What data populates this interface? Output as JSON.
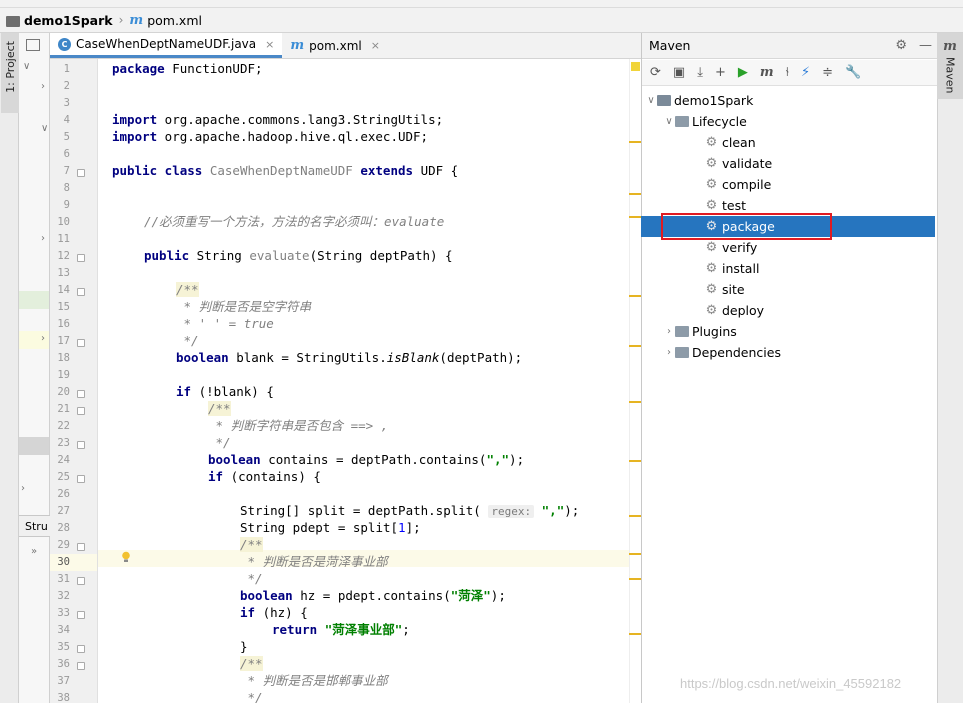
{
  "breadcrumb": {
    "project": "demo1Spark",
    "file": "pom.xml"
  },
  "left_tabs": {
    "project": "1: Project",
    "structure": "Stru"
  },
  "editor_tabs": [
    {
      "label": "CaseWhenDeptNameUDF.java",
      "close": "×",
      "active": true
    },
    {
      "label": "pom.xml",
      "close": "×",
      "active": false
    }
  ],
  "line_numbers": [
    "1",
    "2",
    "3",
    "4",
    "5",
    "6",
    "7",
    "8",
    "9",
    "10",
    "11",
    "12",
    "13",
    "14",
    "15",
    "16",
    "17",
    "18",
    "19",
    "20",
    "21",
    "22",
    "23",
    "24",
    "25",
    "26",
    "27",
    "28",
    "29",
    "30",
    "31",
    "32",
    "33",
    "34",
    "35",
    "36",
    "37",
    "38"
  ],
  "code": {
    "l1a": "package",
    "l1b": " FunctionUDF;",
    "l4a": "import",
    "l4b": " org.apache.commons.lang3.StringUtils;",
    "l5a": "import",
    "l5b": " org.apache.hadoop.hive.ql.exec.UDF;",
    "l7a": "public class",
    "l7b": " CaseWhenDeptNameUDF ",
    "l7c": "extends",
    "l7d": " UDF {",
    "l10": "//必须重写一个方法，方法的名字必须叫：evaluate",
    "l12a": "public",
    "l12b": " String ",
    "l12c": "evaluate",
    "l12d": "(String deptPath) {",
    "l14": "/**",
    "l15": " * 判断是否是空字符串",
    "l16a": " * ' ' = ",
    "l16b": "true",
    "l17": " */",
    "l18a": "boolean",
    "l18b": " blank = StringUtils.",
    "l18c": "isBlank",
    "l18d": "(deptPath);",
    "l20a": "if",
    "l20b": " (!blank) {",
    "l21": "/**",
    "l22": " * 判断字符串是否包含 ==> ,",
    "l23": " */",
    "l24a": "boolean",
    "l24b": " contains = deptPath.contains(",
    "l24c": "\",\"",
    "l24d": ");",
    "l25a": "if",
    "l25b": " (contains) {",
    "l27a": "String[] split = deptPath.split( ",
    "l27hint": "regex:",
    "l27b": " ",
    "l27c": "\",\"",
    "l27d": ");",
    "l28a": "String pdept = split[",
    "l28b": "1",
    "l28c": "];",
    "l29": "/**",
    "l30": " * 判断是否是菏泽事业部",
    "l31": " */",
    "l32a": "boolean",
    "l32b": " hz = pdept.contains(",
    "l32c": "\"菏泽\"",
    "l32d": ");",
    "l33a": "if",
    "l33b": " (hz) {",
    "l34a": "return",
    "l34b": " ",
    "l34c": "\"菏泽事业部\"",
    "l34d": ";",
    "l35": "}",
    "l36": "/**",
    "l37": " * 判断是否是邯郸事业部",
    "l38": " */"
  },
  "maven": {
    "title": "Maven",
    "side_tab": "Maven",
    "project": "demo1Spark",
    "lifecycle": "Lifecycle",
    "goals": [
      "clean",
      "validate",
      "compile",
      "test",
      "package",
      "verify",
      "install",
      "site",
      "deploy"
    ],
    "selected_goal": "package",
    "plugins": "Plugins",
    "dependencies": "Dependencies"
  },
  "watermark": "https://blog.csdn.net/weixin_45592182",
  "colors": {
    "selection": "#2675bf",
    "highlight_box": "#e11b22",
    "keyword": "#000080",
    "string": "#008000"
  }
}
